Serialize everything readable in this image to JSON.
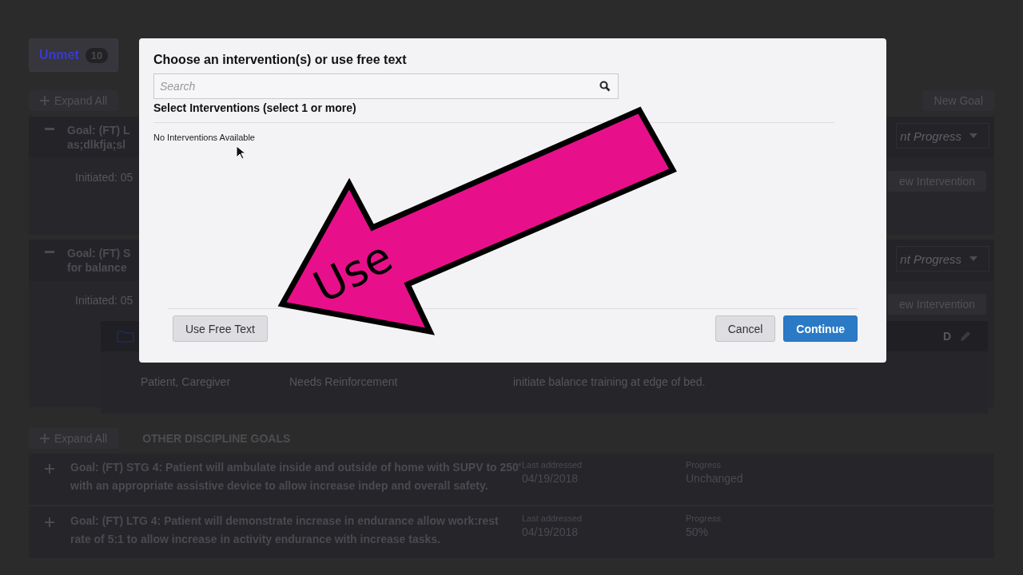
{
  "tabs": [
    {
      "label": "Unmet",
      "count": "10",
      "selected": true
    }
  ],
  "toolbar": {
    "expand_all": "Expand All",
    "new_goal": "New Goal"
  },
  "goals": [
    {
      "title": "Goal: (FT) L",
      "title_line2": "as;dlkfja;sl",
      "progress": "nt Progress",
      "initiated": "Initiated: 05",
      "new_intervention": "ew Intervention",
      "expanded": true
    },
    {
      "title": "Goal: (FT) S",
      "title_line2": "for balance",
      "progress": "nt Progress",
      "initiated": "Initiated: 05",
      "new_intervention": "ew Intervention",
      "expanded": true,
      "table_header_letter": "D",
      "row": [
        "Patient, Caregiver",
        "Needs Reinforcement",
        "initiate balance training at edge of bed."
      ]
    }
  ],
  "other_section": {
    "expand_all": "Expand All",
    "title": "OTHER DISCIPLINE GOALS",
    "goals": [
      {
        "title": "Goal: (FT) STG 4: Patient will ambulate inside and outside of home with SUPV to 250' with an appropriate assistive device to allow increase indep and overall safety.",
        "expanded": false,
        "last_label": "Last addressed",
        "last_value": "04/19/2018",
        "progress_label": "Progress",
        "progress_value": "Unchanged"
      },
      {
        "title": "Goal: (FT) LTG 4: Patient will demonstrate increase in endurance allow work:rest rate of 5:1 to allow increase in activity endurance with increase tasks.",
        "expanded": false,
        "last_label": "Last addressed",
        "last_value": "04/19/2018",
        "progress_label": "Progress",
        "progress_value": "50%"
      }
    ]
  },
  "modal": {
    "title": "Choose an intervention(s) or use free text",
    "search": {
      "placeholder": "Search"
    },
    "subtitle": "Select Interventions (select 1 or more)",
    "empty": "No Interventions Available",
    "buttons": [
      {
        "label": "Use Free Text",
        "kind": "secondary"
      },
      {
        "label": "Cancel",
        "kind": "secondary"
      },
      {
        "label": "Continue",
        "kind": "primary"
      }
    ]
  },
  "annotation": {
    "label": "Use"
  }
}
